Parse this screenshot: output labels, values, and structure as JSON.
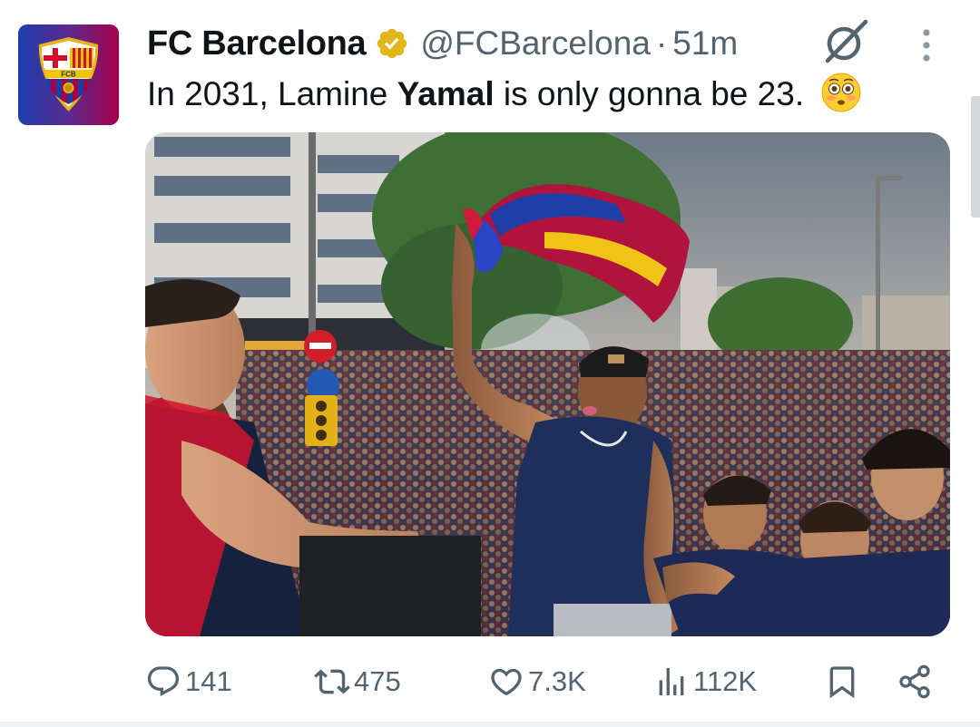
{
  "author": {
    "display_name": "FC Barcelona",
    "handle": "@FCBarcelona",
    "separator": "·",
    "time": "51m",
    "avatar_icon": "fc-barcelona-crest-icon",
    "verified_icon": "gold-verified-badge-icon"
  },
  "tweet": {
    "text_before": "In 2031, Lamine ",
    "text_bold": "Yamal",
    "text_after": " is only gonna be 23.",
    "emoji": "flushed-face-emoji"
  },
  "media": {
    "type": "photo",
    "description_icon": "celebration-photo"
  },
  "actions": {
    "replies": "141",
    "reposts": "475",
    "likes": "7.3K",
    "views": "112K"
  },
  "colors": {
    "text_primary": "#0f1419",
    "text_secondary": "#536471",
    "verified_gold": "#e2b719",
    "barca_blue": "#1d3fa0",
    "barca_garnet": "#a50044"
  }
}
